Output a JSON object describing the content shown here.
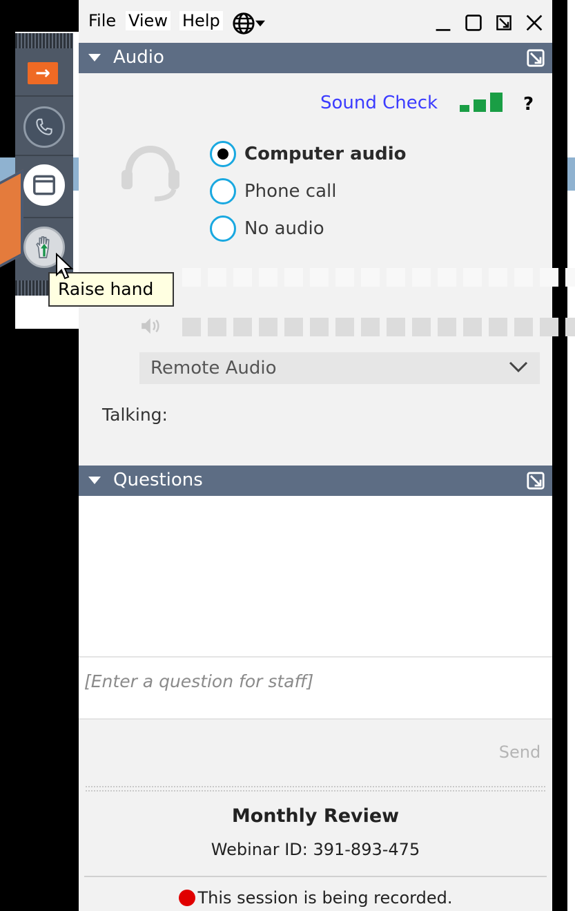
{
  "menu": {
    "file": "File",
    "view": "View",
    "help": "Help"
  },
  "sidebar_tooltip": "Raise hand",
  "audio": {
    "header": "Audio",
    "sound_check": "Sound Check",
    "help": "?",
    "options": [
      {
        "label": "Computer audio",
        "selected": true
      },
      {
        "label": "Phone call",
        "selected": false
      },
      {
        "label": "No audio",
        "selected": false
      }
    ],
    "device": "Remote Audio",
    "talking_label": "Talking:"
  },
  "questions": {
    "header": "Questions",
    "placeholder": "[Enter a question for staff]",
    "send": "Send"
  },
  "footer": {
    "title": "Monthly Review",
    "webinar_id": "Webinar ID: 391-893-475",
    "recording": "This session is being recorded."
  },
  "colors": {
    "header": "#5d6d84",
    "link": "#3b3bff",
    "radio": "#19a8e0",
    "accent_orange": "#ef6a24",
    "record": "#e00000",
    "signal": "#1a9e45"
  },
  "icons": [
    "arrow-right-icon",
    "phone-icon",
    "window-icon",
    "raise-hand-icon",
    "globe-icon",
    "minimize-icon",
    "maximize-icon",
    "popout-icon",
    "close-icon",
    "headset-icon",
    "speaker-icon",
    "chevron-down-icon"
  ]
}
